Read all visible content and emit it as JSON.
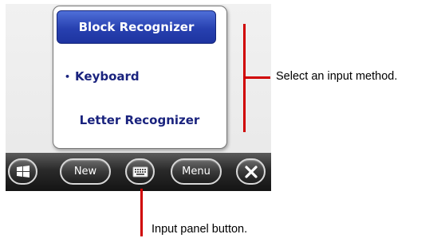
{
  "input_menu": {
    "items": [
      {
        "label": "Block Recognizer",
        "selected": true
      },
      {
        "label": "Keyboard",
        "active_bullet": "•"
      },
      {
        "label": "Letter Recognizer"
      }
    ]
  },
  "taskbar": {
    "start_icon": "windows-logo-icon",
    "new_label": "New",
    "input_icon": "keyboard-icon",
    "menu_label": "Menu",
    "close_icon": "close-icon"
  },
  "annotations": {
    "select_method": "Select an input method.",
    "input_panel": "Input panel button."
  },
  "colors": {
    "callout": "#d00000",
    "selected_bg": "#2740b0",
    "menu_text": "#1a237e"
  }
}
